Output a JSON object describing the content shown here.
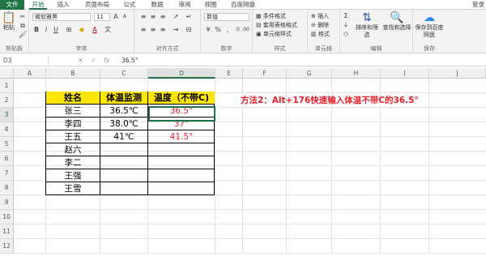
{
  "tabs": [
    "文件",
    "开始",
    "插入",
    "页面布局",
    "公式",
    "数据",
    "审阅",
    "视图",
    "百度网盘"
  ],
  "login": "登录",
  "ribbon": {
    "clipboard": {
      "paste": "粘贴",
      "label": "剪贴板"
    },
    "font": {
      "name": "微软雅黑",
      "size": "11",
      "label": "字体"
    },
    "align": {
      "label": "对齐方式"
    },
    "number": {
      "format": "数值",
      "label": "数字"
    },
    "styles": {
      "cond": "条件格式",
      "table": "套用表格格式",
      "cell": "单元格样式",
      "label": "样式"
    },
    "cells": {
      "insert": "插入",
      "delete": "删除",
      "format": "格式",
      "label": "单元格"
    },
    "edit": {
      "sort": "排序和筛选",
      "find": "查找和选择",
      "label": "编辑"
    },
    "save": {
      "btn": "保存到百度网盘",
      "label": "保存"
    }
  },
  "formula": {
    "cell": "D3",
    "value": "36.5°"
  },
  "columns": [
    "A",
    "B",
    "C",
    "D",
    "E",
    "F",
    "G",
    "H",
    "I",
    "J"
  ],
  "rows": [
    "1",
    "2",
    "3",
    "4",
    "5",
    "6",
    "7",
    "8",
    "9",
    "10",
    "11",
    "12"
  ],
  "table": {
    "headers": [
      "姓名",
      "体温监测",
      "温度（不带C)"
    ],
    "rows": [
      [
        "张三",
        "36.5℃",
        "36.5°"
      ],
      [
        "李四",
        "38.0℃",
        "37°"
      ],
      [
        "王五",
        "41℃",
        "41.5°"
      ],
      [
        "赵六",
        "",
        ""
      ],
      [
        "李二",
        "",
        ""
      ],
      [
        "王强",
        "",
        ""
      ],
      [
        "王雪",
        "",
        ""
      ]
    ]
  },
  "note": "方法2：Alt+176快速输入体温不带C的36.5°",
  "colors": {
    "accent": "#217346",
    "header_fill": "#ffe600",
    "red_text": "#e8202a"
  }
}
